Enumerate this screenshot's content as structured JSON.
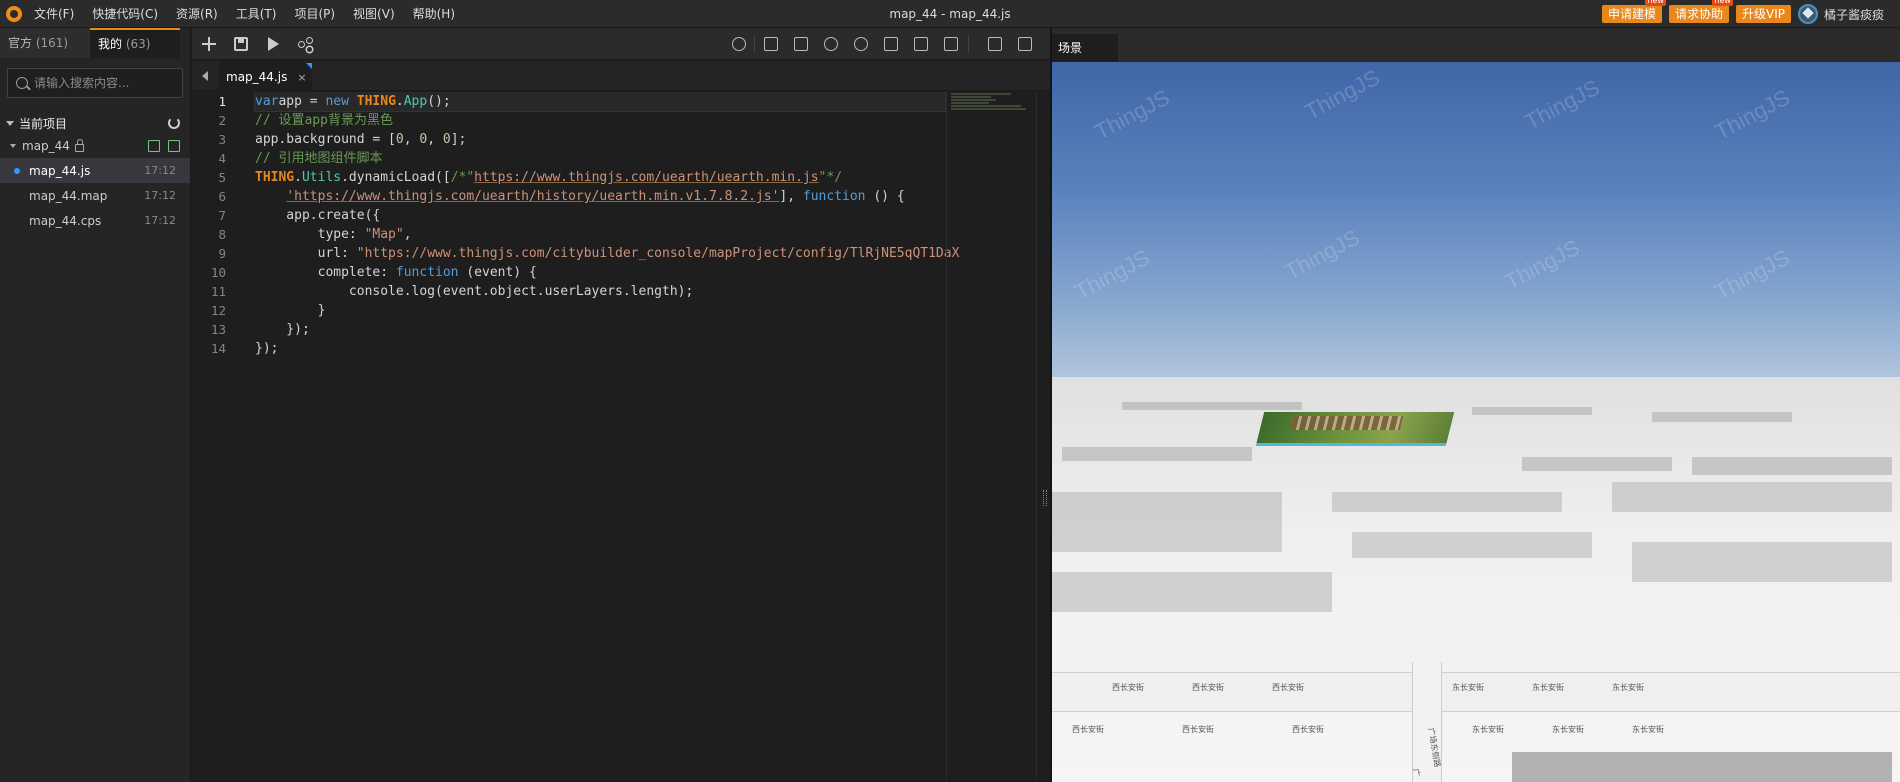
{
  "menubar": {
    "items": [
      "文件(F)",
      "快捷代码(C)",
      "资源(R)",
      "工具(T)",
      "项目(P)",
      "视图(V)",
      "帮助(H)"
    ],
    "window_title": "map_44 - map_44.js",
    "buttons": [
      {
        "label": "申请建模",
        "badge": "new"
      },
      {
        "label": "请求协助",
        "badge": "new"
      },
      {
        "label": "升级VIP",
        "badge": ""
      }
    ],
    "user_name": "橘子酱痰痰"
  },
  "sidebar": {
    "tabs": [
      {
        "label": "官方",
        "count": "(161)"
      },
      {
        "label": "我的",
        "count": "(63)"
      }
    ],
    "search_placeholder": "请输入搜索内容...",
    "section_title": "当前项目",
    "project_name": "map_44",
    "files": [
      {
        "name": "map_44.js",
        "time": "17:12"
      },
      {
        "name": "map_44.map",
        "time": "17:12"
      },
      {
        "name": "map_44.cps",
        "time": "17:12"
      }
    ]
  },
  "editor": {
    "tab_label": "map_44.js",
    "tab_close": "×",
    "line_numbers": [
      "1",
      "2",
      "3",
      "4",
      "5",
      "6",
      "7",
      "8",
      "9",
      "10",
      "11",
      "12",
      "13",
      "14"
    ]
  },
  "scene": {
    "tab_label": "场景",
    "watermark": "ThingJS",
    "street_labels": [
      "西长安街",
      "西长安街",
      "西长安街",
      "东长安街",
      "东长安街",
      "东长安街",
      "西长安街",
      "西长安街",
      "西长安街",
      "东长安街",
      "东长安街",
      "东长安街",
      "广场东侧路",
      "广"
    ]
  },
  "colors": {
    "accent_orange": "#e8871c",
    "badge_red": "#e64a19",
    "active_dot": "#3794ff"
  },
  "icons": [
    "plus-icon",
    "save-icon",
    "run-icon",
    "share-icon",
    "refresh-icon",
    "lock-icon",
    "search-icon"
  ]
}
